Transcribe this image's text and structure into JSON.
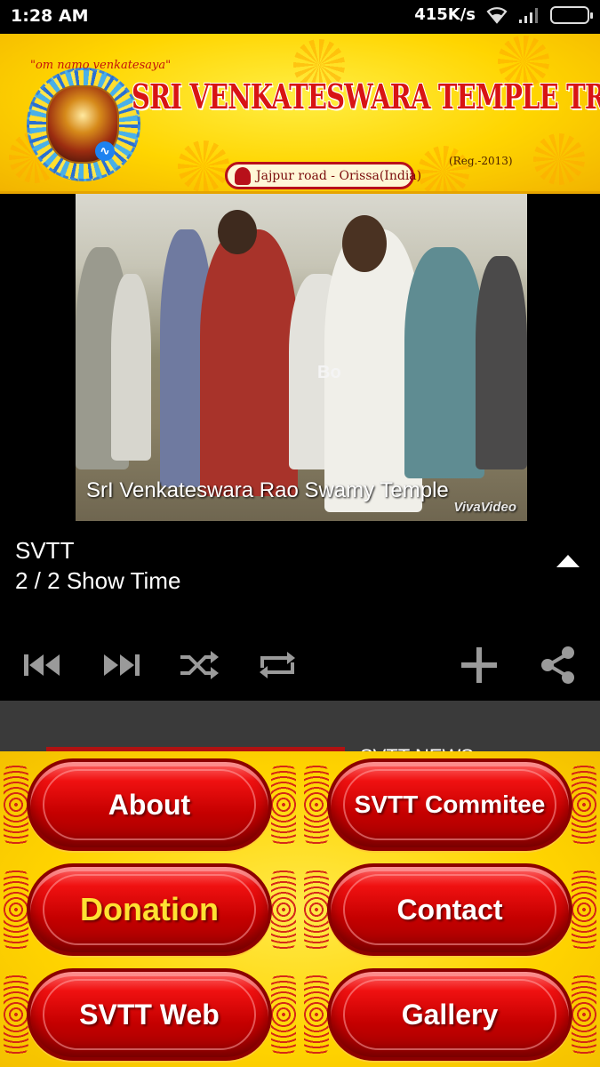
{
  "status_bar": {
    "time": "1:28 AM",
    "network_speed": "415K/s",
    "icons": [
      "wifi-icon",
      "signal-icon",
      "battery-icon"
    ]
  },
  "banner": {
    "om_tag": "\"om namo venkatesaya\"",
    "title": "SRI VENKATESWARA TEMPLE TRUST",
    "registration": "(Reg.-2013)",
    "address": "Jajpur road - Orissa(India)",
    "colors": {
      "background": "#ffd500",
      "title": "#d81414"
    }
  },
  "player": {
    "video": {
      "caption": "SrI Venkateswara Rao Swamy Temple",
      "watermark": "VivaVideo",
      "overlay_mark": "Bo"
    },
    "track_title": "SVTT",
    "track_subtitle": "2 / 2  Show Time",
    "controls": [
      "skip-previous-icon",
      "skip-next-icon",
      "shuffle-icon",
      "repeat-icon",
      "add-icon",
      "share-icon"
    ]
  },
  "peek": {
    "text": "SVTT NEWS"
  },
  "menu": {
    "buttons": [
      {
        "label": "About",
        "color": "#ffffff"
      },
      {
        "label": "SVTT Commitee",
        "color": "#ffffff"
      },
      {
        "label": "Donation",
        "color": "#ffe132"
      },
      {
        "label": "Contact",
        "color": "#ffffff"
      },
      {
        "label": "SVTT Web",
        "color": "#ffffff"
      },
      {
        "label": "Gallery",
        "color": "#ffffff"
      }
    ],
    "button_color": "#d40000",
    "panel_color": "#ffd400"
  }
}
